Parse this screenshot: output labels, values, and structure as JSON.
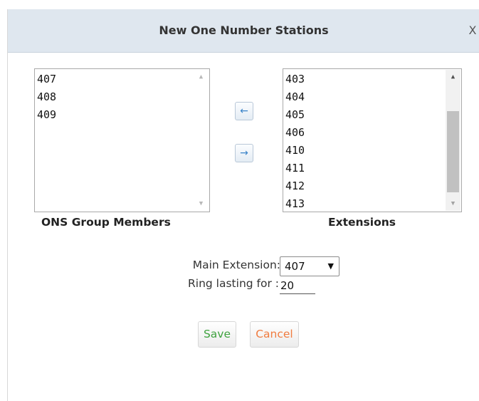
{
  "dialog": {
    "title": "New One Number Stations",
    "close_label": "X"
  },
  "members": {
    "label": "ONS Group Members",
    "items": [
      "407",
      "408",
      "409"
    ]
  },
  "extensions": {
    "label": "Extensions",
    "items": [
      "403",
      "404",
      "405",
      "406",
      "410",
      "411",
      "412",
      "413"
    ]
  },
  "transfer": {
    "add_arrow": "←",
    "remove_arrow": "→"
  },
  "main_extension": {
    "label": "Main Extension:",
    "value": "407"
  },
  "ring": {
    "label": "Ring lasting for :",
    "value": "20"
  },
  "buttons": {
    "save_label": "Save",
    "cancel_label": "Cancel",
    "save_color": "#3fa23f",
    "cancel_color": "#f07c40"
  },
  "colors": {
    "titlebar_bg": "#dfe7ef",
    "arrow_color": "#3a84c9"
  }
}
